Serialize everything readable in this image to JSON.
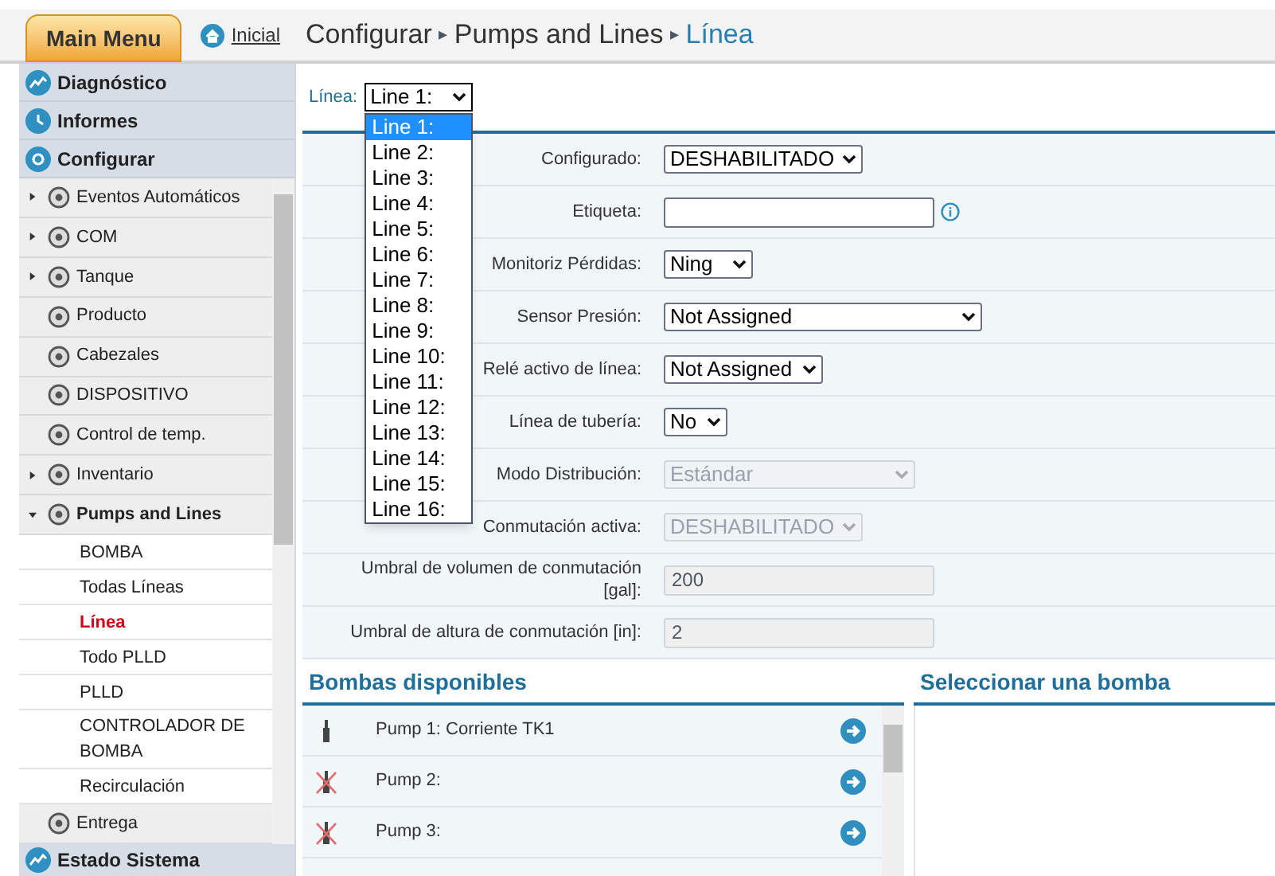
{
  "header": {
    "main_menu": "Main Menu",
    "home_link": "Inicial",
    "breadcrumb": [
      {
        "label": "Configurar",
        "current": false
      },
      {
        "label": "Pumps and Lines",
        "current": false
      },
      {
        "label": "Línea",
        "current": true
      }
    ],
    "separator": "▸"
  },
  "sidebar": {
    "sections": [
      {
        "label": "Diagnóstico"
      },
      {
        "label": "Informes"
      },
      {
        "label": "Configurar"
      }
    ],
    "items": [
      {
        "label": "Eventos Automáticos",
        "has_children": true,
        "expanded": false
      },
      {
        "label": "COM",
        "has_children": true,
        "expanded": false
      },
      {
        "label": "Tanque",
        "has_children": true,
        "expanded": false
      },
      {
        "label": "Producto",
        "has_children": false,
        "expanded": false
      },
      {
        "label": "Cabezales",
        "has_children": false,
        "expanded": false
      },
      {
        "label": "DISPOSITIVO",
        "has_children": false,
        "expanded": false
      },
      {
        "label": "Control de temp.",
        "has_children": false,
        "expanded": false
      },
      {
        "label": "Inventario",
        "has_children": true,
        "expanded": false
      },
      {
        "label": "Pumps and Lines",
        "has_children": true,
        "expanded": true,
        "children": [
          {
            "label": "BOMBA",
            "selected": false
          },
          {
            "label": "Todas Líneas",
            "selected": false
          },
          {
            "label": "Línea",
            "selected": true
          },
          {
            "label": "Todo PLLD",
            "selected": false
          },
          {
            "label": "PLLD",
            "selected": false
          },
          {
            "label": "CONTROLADOR DE BOMBA",
            "selected": false
          },
          {
            "label": "Recirculación",
            "selected": false
          }
        ]
      },
      {
        "label": "Entrega",
        "has_children": false,
        "expanded": false
      }
    ],
    "footer": {
      "label": "Estado Sistema"
    }
  },
  "line_select": {
    "label": "Línea:",
    "value": "Line 1:",
    "expanded": true,
    "options": [
      {
        "label": "Line 1:",
        "selected": true
      },
      {
        "label": "Line 2:",
        "selected": false
      },
      {
        "label": "Line 3:",
        "selected": false
      },
      {
        "label": "Line 4:",
        "selected": false
      },
      {
        "label": "Line 5:",
        "selected": false
      },
      {
        "label": "Line 6:",
        "selected": false
      },
      {
        "label": "Line 7:",
        "selected": false
      },
      {
        "label": "Line 8:",
        "selected": false
      },
      {
        "label": "Line 9:",
        "selected": false
      },
      {
        "label": "Line 10:",
        "selected": false
      },
      {
        "label": "Line 11:",
        "selected": false
      },
      {
        "label": "Line 12:",
        "selected": false
      },
      {
        "label": "Line 13:",
        "selected": false
      },
      {
        "label": "Line 14:",
        "selected": false
      },
      {
        "label": "Line 15:",
        "selected": false
      },
      {
        "label": "Line 16:",
        "selected": false
      }
    ]
  },
  "form": [
    {
      "label": "Configurado:",
      "kind": "select",
      "value": "DESHABILITADO",
      "disabled": false
    },
    {
      "label": "Etiqueta:",
      "kind": "text",
      "disabled": false,
      "info": true
    },
    {
      "label": "Monitoriz Pérdidas:",
      "kind": "select",
      "value": "Ning",
      "disabled": false
    },
    {
      "label": "Sensor Presión:",
      "kind": "select",
      "value": "Not Assigned",
      "disabled": false
    },
    {
      "label": "Relé activo de línea:",
      "kind": "select",
      "value": "Not Assigned",
      "disabled": false
    },
    {
      "label": "Línea de tubería:",
      "kind": "select",
      "value": "No",
      "disabled": false
    },
    {
      "label": "Modo Distribución:",
      "kind": "select",
      "value": "Estándar",
      "disabled": true
    },
    {
      "label": "Conmutación activa:",
      "kind": "select",
      "value": "DESHABILITADO",
      "disabled": true
    },
    {
      "label": "Umbral de volumen de conmutación [gal]:",
      "kind": "text",
      "value": "200",
      "disabled": true
    },
    {
      "label": "Umbral de altura de conmutación [in]:",
      "kind": "text",
      "value": "2",
      "disabled": true
    }
  ],
  "available_pumps": {
    "title": "Bombas disponibles",
    "rows": [
      {
        "name": "Pump 1: Corriente TK1",
        "available": true
      },
      {
        "name": "Pump 2:",
        "available": false
      },
      {
        "name": "Pump 3:",
        "available": false
      }
    ]
  },
  "selected_pump": {
    "title": "Seleccionar una bomba"
  }
}
